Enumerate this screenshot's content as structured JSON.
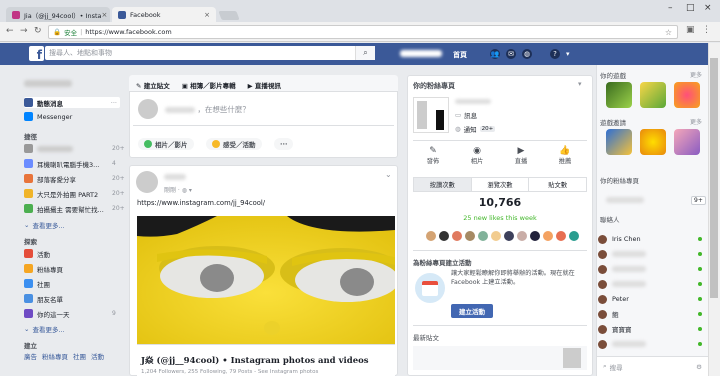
{
  "browser": {
    "tabs": [
      {
        "label": "Jia（@jj_94cool）• Insta",
        "color": "#c13584"
      },
      {
        "label": "Facebook",
        "color": "#3b5998"
      }
    ],
    "secure_label": "安全",
    "url": "https://www.facebook.com"
  },
  "header": {
    "logo": "f",
    "search_placeholder": "搜尋人、地點和事物",
    "home_label": "首頁",
    "icons": [
      "friends-icon",
      "messenger-icon",
      "globe-icon",
      "help-icon",
      "caret-down-icon"
    ]
  },
  "left_nav": {
    "items": [
      {
        "label": "動態消息",
        "color": "#3b5998"
      },
      {
        "label": "Messenger",
        "color": "#0084ff"
      }
    ],
    "shortcuts_title": "捷徑",
    "shortcuts": [
      {
        "label": "",
        "count": "20+",
        "color": "#999"
      },
      {
        "label": "耳機喇叭電腦手機3...",
        "count": "4",
        "color": "#6b8cff"
      },
      {
        "label": "部落客愛分享",
        "count": "20+",
        "color": "#e8743b"
      },
      {
        "label": "大只是外拍團 PART2",
        "count": "20+",
        "color": "#f0b429"
      },
      {
        "label": "拍攝攝主 需要幫忙找...",
        "count": "20+",
        "color": "#4caf50"
      }
    ],
    "see_more_1": "查看更多...",
    "explore_title": "探索",
    "explore": [
      {
        "label": "活動",
        "color": "#e44d3a"
      },
      {
        "label": "粉絲專頁",
        "color": "#f5a623"
      },
      {
        "label": "社團",
        "color": "#3b8ff0"
      },
      {
        "label": "朋友名單",
        "color": "#4a90e2"
      },
      {
        "label": "你的這一天",
        "count": "9",
        "color": "#6f4bc4"
      }
    ],
    "see_more_2": "查看更多...",
    "create_title": "建立",
    "create_links": [
      "廣告",
      "粉絲專頁",
      "社團",
      "活動"
    ]
  },
  "composer": {
    "tabs": [
      {
        "label": "建立貼文",
        "icon": "pencil-icon"
      },
      {
        "label": "相簿／影片專輯",
        "icon": "album-icon"
      },
      {
        "label": "直播視訊",
        "icon": "video-icon"
      }
    ],
    "placeholder": "，在想些什麼？",
    "actions": [
      {
        "label": "相片／影片",
        "color": "#45bd62"
      },
      {
        "label": "感受／活動",
        "color": "#f7b928"
      }
    ],
    "more": "···"
  },
  "post": {
    "name": "Jia 分享了",
    "meta": "剛剛 · ",
    "link_text": "https://www.instagram.com/jj_94cool/",
    "link_title": "J焱 (@jj__94cool) • Instagram photos and videos",
    "link_sub": "1,204 Followers, 255 Following, 79 Posts - See Instagram photos"
  },
  "page_panel": {
    "title": "你的粉絲專頁",
    "links": [
      {
        "label": "訊息",
        "icon": "message-icon"
      },
      {
        "label": "通知",
        "icon": "globe-icon",
        "badge": "20+"
      }
    ],
    "actions": [
      "發佈",
      "相片",
      "直播",
      "推薦"
    ],
    "tabs": [
      "按讚次數",
      "瀏覽次數",
      "貼文數"
    ],
    "likes_count": "10,766",
    "likes_week": "25 new likes this week",
    "event_title": "為粉絲專頁建立活動",
    "event_desc": "讓大家輕鬆瞭解你即將舉辦的活動。現在就在 Facebook 上建立活動。",
    "event_button": "建立活動",
    "recent_title": "最新貼文"
  },
  "right_sidebar": {
    "games_title": "你的遊戲",
    "more": "更多",
    "games_suggest_title": "遊戲邀請",
    "pages_title": "你的粉絲專頁",
    "badge": "9+",
    "contacts_title": "聯絡人",
    "contacts": [
      "Iris Chen",
      "",
      "",
      "",
      "Peter",
      "飽",
      "寶寶寶",
      ""
    ],
    "search_placeholder": "搜尋"
  }
}
